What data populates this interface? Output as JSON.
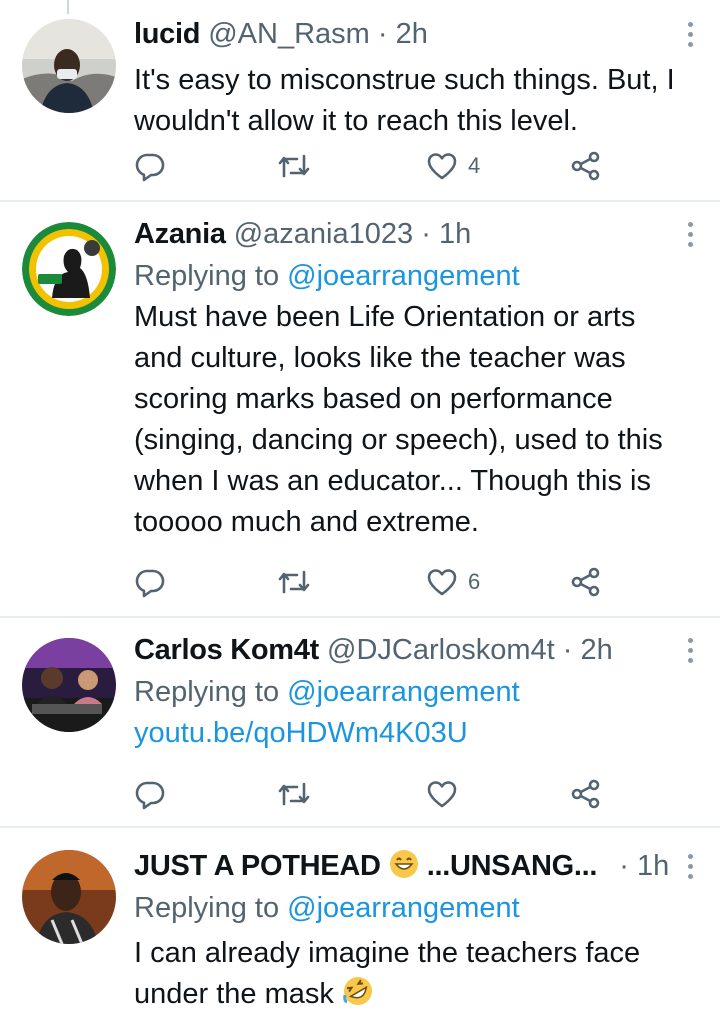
{
  "tweets": [
    {
      "name": "lucid",
      "handle": "@AN_Rasm",
      "dot": "·",
      "time": "2h",
      "reply_prefix": "",
      "reply_mention": "",
      "lines": [
        "It's easy to misconstrue such things. But, I",
        "wouldn't allow it to reach this level."
      ],
      "link": "",
      "like_count": "4"
    },
    {
      "name": "Azania",
      "handle": "@azania1023",
      "dot": "·",
      "time": "1h",
      "reply_prefix": "Replying to",
      "reply_mention": "@joearrangement",
      "lines": [
        "Must have been Life Orientation or arts",
        "and culture, looks like the teacher was",
        "scoring marks based on performance",
        "(singing, dancing or speech), used to this",
        "when I was an educator... Though this is",
        "tooooo much and extreme."
      ],
      "link": "",
      "like_count": "6"
    },
    {
      "name": "Carlos Kom4t",
      "handle": "@DJCarloskom4t",
      "dot": "·",
      "time": "2h",
      "reply_prefix": "Replying to",
      "reply_mention": "@joearrangement",
      "lines": [],
      "link": "youtu.be/qoHDWm4K03U",
      "like_count": ""
    },
    {
      "name_part1": "JUST A POTHEAD",
      "name_part2": "...UNSANG...",
      "handle": "",
      "dot": "·",
      "time": "1h",
      "reply_prefix": "Replying to",
      "reply_mention": "@joearrangement",
      "lines": [
        "I can already imagine the teachers face",
        "under the mask"
      ],
      "link": "",
      "like_count": ""
    }
  ],
  "colors": {
    "text": "#0f1419",
    "secondary": "#536471",
    "link": "#1b95e0",
    "divider": "#e6ecf0"
  },
  "icons": [
    "reply-icon",
    "retweet-icon",
    "like-icon",
    "share-icon",
    "more-icon",
    "grinning-emoji",
    "rofl-emoji"
  ]
}
